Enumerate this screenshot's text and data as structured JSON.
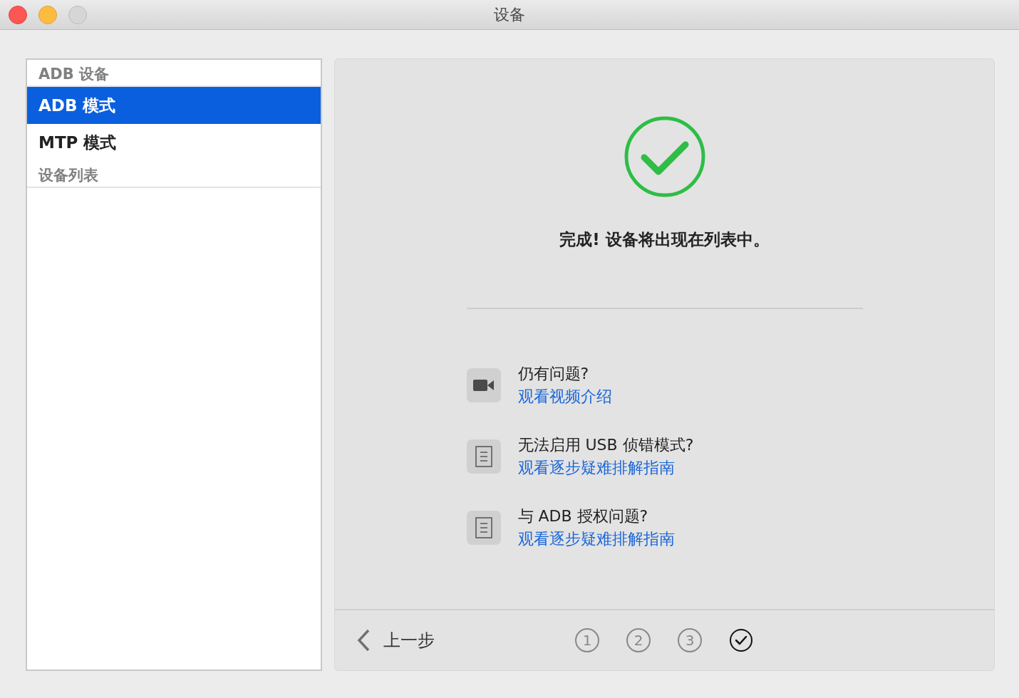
{
  "window": {
    "title": "设备"
  },
  "sidebar": {
    "items": [
      {
        "kind": "header",
        "label": "ADB 设备"
      },
      {
        "kind": "item",
        "label": "ADB 模式",
        "selected": true
      },
      {
        "kind": "item",
        "label": "MTP 模式",
        "selected": false
      },
      {
        "kind": "header",
        "label": "设备列表"
      }
    ]
  },
  "status": {
    "message": "完成! 设备将出现在列表中。"
  },
  "help": [
    {
      "kind": "video",
      "question": "仍有问题?",
      "link": "观看视频介绍"
    },
    {
      "kind": "document",
      "question": "无法启用 USB 侦错模式?",
      "link": "观看逐步疑难排解指南"
    },
    {
      "kind": "document",
      "question": "与 ADB 授权问题?",
      "link": "观看逐步疑难排解指南"
    }
  ],
  "footer": {
    "back": "上一步",
    "steps": [
      {
        "kind": "number",
        "label": "1",
        "selected": false
      },
      {
        "kind": "number",
        "label": "2",
        "selected": false
      },
      {
        "kind": "number",
        "label": "3",
        "selected": false
      },
      {
        "kind": "check",
        "selected": true
      }
    ]
  }
}
